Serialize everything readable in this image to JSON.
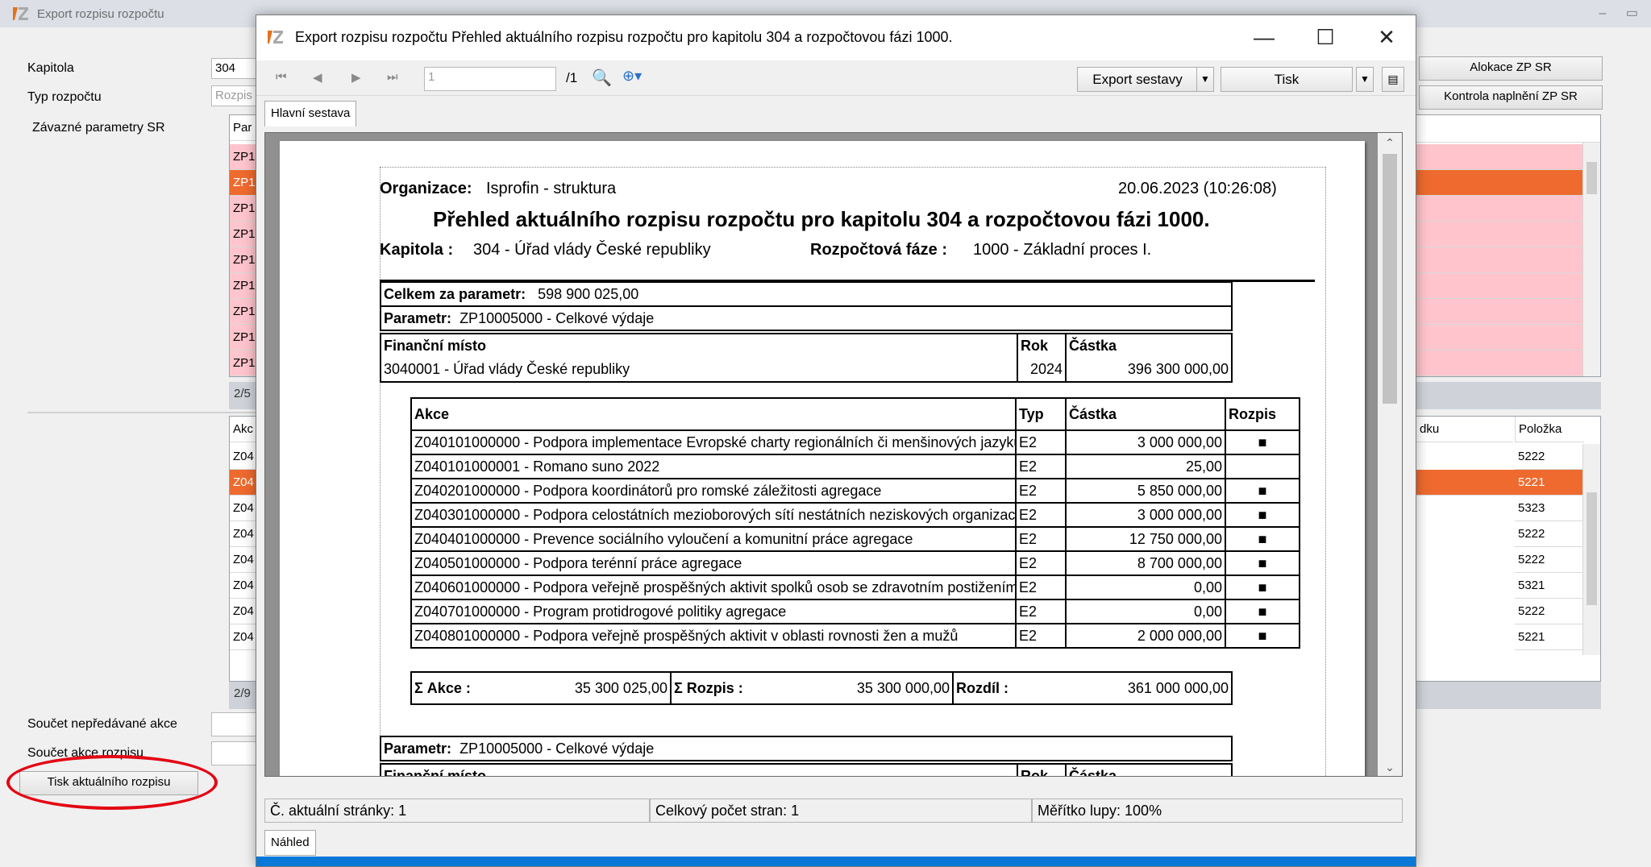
{
  "bg": {
    "title": "Export rozpisu rozpočtu",
    "labels": {
      "kapitola": "Kapitola",
      "typ_rozpoctu": "Typ rozpočtu",
      "zavazne": "Závazné parametry SR",
      "soucet_nepredavane": "Součet nepředávané akce",
      "soucet_akce": "Součet akce rozpisu"
    },
    "kapitola_value": "304",
    "typ_rozpoctu_value": "Rozpis",
    "print_button": "Tisk aktuálního rozpisu",
    "right_buttons": [
      "Alokace ZP SR",
      "Kontrola naplnění ZP SR"
    ],
    "grid1": {
      "header": "Par",
      "rows": [
        "ZP1",
        "ZP1",
        "ZP1",
        "ZP1",
        "ZP1",
        "ZP1",
        "ZP1",
        "ZP1",
        "ZP1"
      ],
      "counter": "2/5"
    },
    "grid2": {
      "header": "Akc",
      "rows": [
        "Z04",
        "Z04",
        "Z04",
        "Z04",
        "Z04",
        "Z04",
        "Z04",
        "Z04"
      ],
      "counter": "2/9"
    },
    "right_grid2": {
      "header_left": "dku",
      "header_right": "Položka",
      "rows": [
        "5222",
        "5221",
        "5323",
        "5222",
        "5222",
        "5321",
        "5222",
        "5221"
      ]
    },
    "colors": {
      "pink": "#ffc4cc",
      "selected": "#ee6a2e"
    }
  },
  "dialog": {
    "title": "Export rozpisu rozpočtu Přehled aktuálního rozpisu rozpočtu pro kapitolu 304 a rozpočtovou fázi 1000.",
    "toolbar": {
      "page_input": "1",
      "page_total": "/1",
      "export_label": "Export sestavy",
      "print_label": "Tisk"
    },
    "tab_main": "Hlavní sestava",
    "tab_bottom": "Náhled",
    "status": {
      "current_page": "Č. aktuální stránky: 1",
      "total_pages": "Celkový počet stran: 1",
      "zoom": "Měřítko lupy: 100%"
    }
  },
  "report": {
    "org_label": "Organizace:",
    "org_value": "Isprofin - struktura",
    "datetime": "20.06.2023 (10:26:08)",
    "heading": "Přehled aktuálního rozpisu rozpočtu pro kapitolu 304 a rozpočtovou fázi 1000.",
    "kapitola_label": "Kapitola :",
    "kapitola_value": "304 - Úřad vlády České republiky",
    "faze_label": "Rozpočtová fáze :",
    "faze_value": "1000 - Základní proces I.",
    "celkem_label": "Celkem za parametr:",
    "celkem_value": "598 900 025,00",
    "param_label": "Parametr:",
    "param_value": "ZP10005000 - Celkové výdaje",
    "fm_header": "Finanční místo",
    "rok_header": "Rok",
    "castka_header": "Částka",
    "fm_row": {
      "name": "3040001 - Úřad vlády České republiky",
      "rok": "2024",
      "castka": "396 300 000,00"
    },
    "akce_headers": {
      "akce": "Akce",
      "typ": "Typ",
      "castka": "Částka",
      "rozpis": "Rozpis"
    },
    "akce_rows": [
      {
        "akce": "Z040101000000 - Podpora implementace Evropské charty regionálních či menšinových jazyků",
        "typ": "E2",
        "castka": "3 000 000,00",
        "rozpis": "■"
      },
      {
        "akce": "Z040101000001 - Romano suno 2022",
        "typ": "E2",
        "castka": "25,00",
        "rozpis": ""
      },
      {
        "akce": "Z040201000000 - Podpora koordinátorů pro romské záležitosti agregace",
        "typ": "E2",
        "castka": "5 850 000,00",
        "rozpis": "■"
      },
      {
        "akce": "Z040301000000 - Podpora celostátních mezioborových sítí nestátních neziskových organizací",
        "typ": "E2",
        "castka": "3 000 000,00",
        "rozpis": "■"
      },
      {
        "akce": "Z040401000000 - Prevence sociálního vyloučení a komunitní práce agregace",
        "typ": "E2",
        "castka": "12 750 000,00",
        "rozpis": "■"
      },
      {
        "akce": "Z040501000000 - Podpora terénní práce agregace",
        "typ": "E2",
        "castka": "8 700 000,00",
        "rozpis": "■"
      },
      {
        "akce": "Z040601000000 - Podpora veřejně prospěšných aktivit spolků osob se zdravotním postižením",
        "typ": "E2",
        "castka": "0,00",
        "rozpis": "■"
      },
      {
        "akce": "Z040701000000 - Program protidrogové politiky agregace",
        "typ": "E2",
        "castka": "0,00",
        "rozpis": "■"
      },
      {
        "akce": "Z040801000000 - Podpora veřejně prospěšných aktivit v oblasti rovnosti žen a mužů",
        "typ": "E2",
        "castka": "2 000 000,00",
        "rozpis": "■"
      }
    ],
    "sum": {
      "akce_label": "Σ Akce :",
      "akce_value": "35 300 025,00",
      "rozpis_label": "Σ Rozpis :",
      "rozpis_value": "35 300 000,00",
      "rozdil_label": "Rozdíl :",
      "rozdil_value": "361 000 000,00"
    },
    "param2_label": "Parametr:",
    "param2_value": "ZP10005000 - Celkové výdaje"
  }
}
